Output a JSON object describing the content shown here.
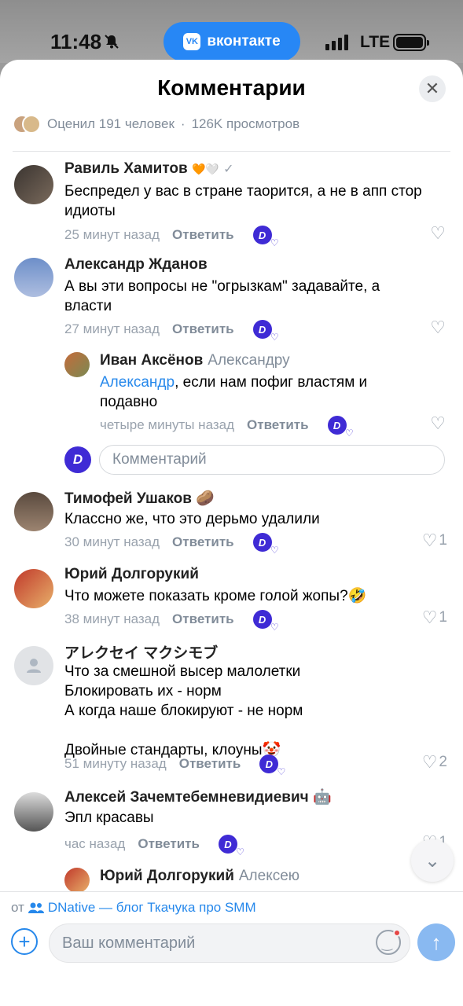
{
  "status_bar": {
    "time": "11:48",
    "network": "LTE",
    "app_pill": "вконтакте",
    "app_logo": "VK"
  },
  "sheet": {
    "title": "Комментарии",
    "stats": {
      "rated": "Оценил 191 человек",
      "separator": "·",
      "views": "126K просмотров"
    }
  },
  "comments": [
    {
      "author": "Равиль Хамитов",
      "badge": "🧡🤍",
      "text": "Беспредел у вас в стране таорится, а не в апп стор\nидиоты",
      "time": "25 минут назад",
      "reply": "Ответить",
      "likes": ""
    },
    {
      "author": "Александр Жданов",
      "text": "А вы эти вопросы не \"огрызкам\" задавайте, а\nвласти",
      "time": "27 минут назад",
      "reply": "Ответить",
      "likes": ""
    },
    {
      "author": "Иван Аксёнов",
      "reply_to": "Александру",
      "mention": "Александр",
      "text": ", если нам пофиг властям и\nподавно",
      "time": "четыре минуты назад",
      "reply": "Ответить",
      "likes": ""
    },
    {
      "author": "Тимофей Ушаков",
      "badge": "🥔",
      "text": "Классно же, что это дерьмо удалили",
      "time": "30 минут назад",
      "reply": "Ответить",
      "likes": "1"
    },
    {
      "author": "Юрий Долгорукий",
      "text": "Что можете показать кроме голой жопы?🤣",
      "time": "38 минут назад",
      "reply": "Ответить",
      "likes": "1"
    },
    {
      "author": "アレクセイ マクシモブ",
      "text": "Что за смешной высер малолетки\nБлокировать их - норм\nА когда наше блокируют - не норм\n\nДвойные стандарты, клоуны🤡",
      "time": "51 минуту назад",
      "reply": "Ответить",
      "likes": "2"
    },
    {
      "author": "Алексей Зачемтебемневидиевич",
      "badge": "🤖",
      "text": "Эпл красавы",
      "time": "час назад",
      "reply": "Ответить",
      "likes": "1"
    },
    {
      "author": "Юрий Долгорукий",
      "reply_to": "Алексею"
    }
  ],
  "reply_input": {
    "placeholder": "Комментарий",
    "avatar_letter": "D"
  },
  "bottom_bar": {
    "from_prefix": "от",
    "community": "DNative — блог Ткачука про SMM",
    "input_placeholder": "Ваш комментарий"
  },
  "icons": {
    "close": "close-icon",
    "scroll_down": "chevron-down-icon",
    "send": "arrow-up-icon",
    "add": "plus-icon",
    "emoji": "smile-icon",
    "like": "heart-icon"
  },
  "colors": {
    "accent": "#2688eb",
    "pill": "#2787f5",
    "author_badge": "#3f2bd5",
    "send_disabled": "#89b9f1"
  }
}
